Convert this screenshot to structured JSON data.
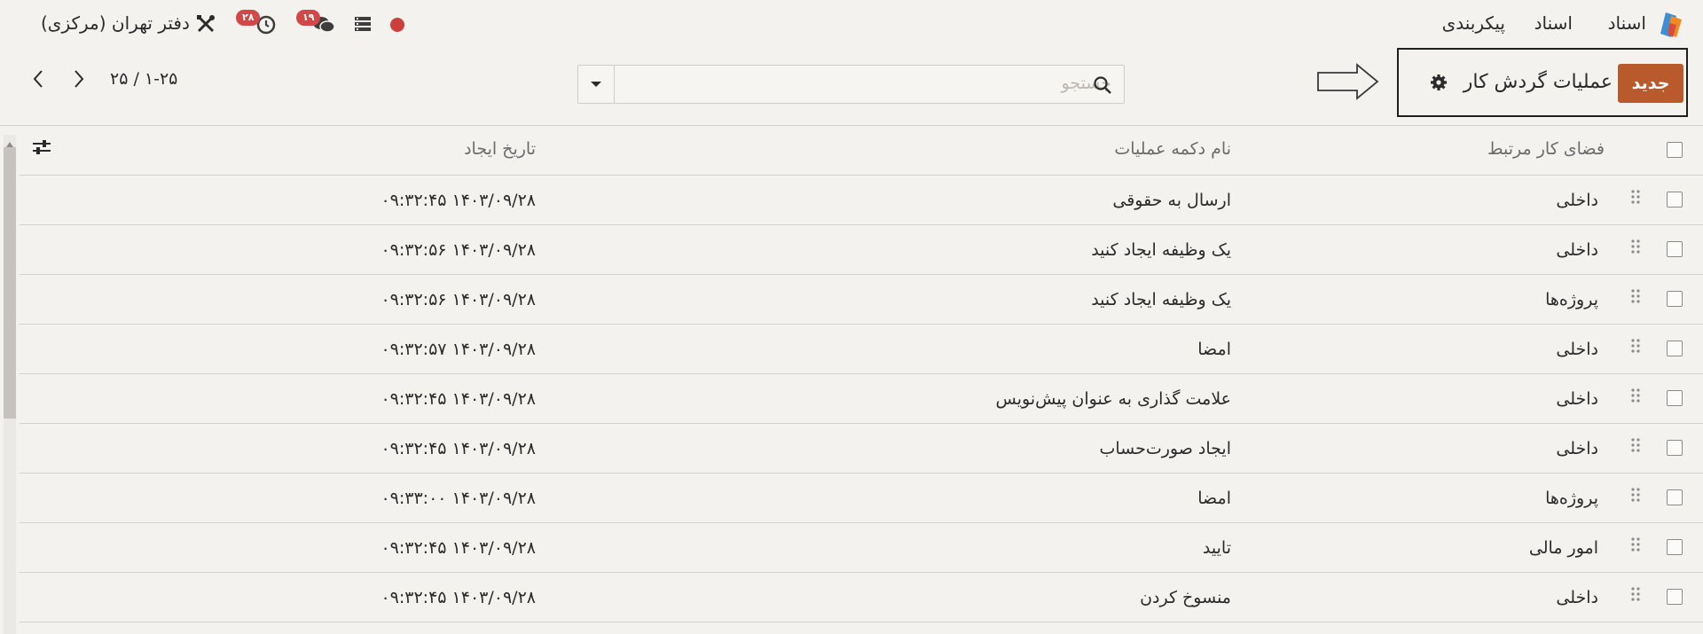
{
  "nav": {
    "app_name": "اسناد",
    "menu": [
      "اسناد",
      "پیکربندی"
    ],
    "company": "دفتر تهران (مرکزی)",
    "activity_count": "۲۸",
    "messages_count": "۱۹"
  },
  "control": {
    "new_button": "جدید",
    "title": "عملیات گردش کار",
    "search_placeholder": "جستجو",
    "pager": "۱-۲۵ / ۲۵"
  },
  "table": {
    "columns": {
      "workspace": "فضای کار مرتبط",
      "action_name": "نام دکمه عملیات",
      "created": "تاریخ ایجاد"
    },
    "rows": [
      {
        "workspace": "داخلی",
        "action_name": "ارسال به حقوقی",
        "created": "۱۴۰۳/۰۹/۲۸ ۰۹:۳۲:۴۵"
      },
      {
        "workspace": "داخلی",
        "action_name": "یک وظیفه ایجاد کنید",
        "created": "۱۴۰۳/۰۹/۲۸ ۰۹:۳۲:۵۶"
      },
      {
        "workspace": "پروژه‌ها",
        "action_name": "یک وظیفه ایجاد کنید",
        "created": "۱۴۰۳/۰۹/۲۸ ۰۹:۳۲:۵۶"
      },
      {
        "workspace": "داخلی",
        "action_name": "امضا",
        "created": "۱۴۰۳/۰۹/۲۸ ۰۹:۳۲:۵۷"
      },
      {
        "workspace": "داخلی",
        "action_name": "علامت گذاری به عنوان پیش‌نویس",
        "created": "۱۴۰۳/۰۹/۲۸ ۰۹:۳۲:۴۵"
      },
      {
        "workspace": "داخلی",
        "action_name": "ایجاد صورت‌حساب",
        "created": "۱۴۰۳/۰۹/۲۸ ۰۹:۳۲:۴۵"
      },
      {
        "workspace": "پروژه‌ها",
        "action_name": "امضا",
        "created": "۱۴۰۳/۰۹/۲۸ ۰۹:۳۳:۰۰"
      },
      {
        "workspace": "امور مالی",
        "action_name": "تایید",
        "created": "۱۴۰۳/۰۹/۲۸ ۰۹:۳۲:۴۵"
      },
      {
        "workspace": "داخلی",
        "action_name": "منسوخ کردن",
        "created": "۱۴۰۳/۰۹/۲۸ ۰۹:۳۲:۴۵"
      }
    ]
  },
  "colors": {
    "background": "#f3f2ef",
    "primary_button": "#b85a2c",
    "badge": "#d24747",
    "record_dot": "#c9403c"
  },
  "icons": [
    "app-logo-icon",
    "record-dot-icon",
    "server-icon",
    "chat-icon",
    "clock-icon",
    "tools-icon",
    "gear-icon",
    "arrow-right-icon",
    "search-icon",
    "caret-down-icon",
    "chevron-left-icon",
    "chevron-right-icon",
    "column-settings-icon",
    "drag-handle-icon"
  ]
}
